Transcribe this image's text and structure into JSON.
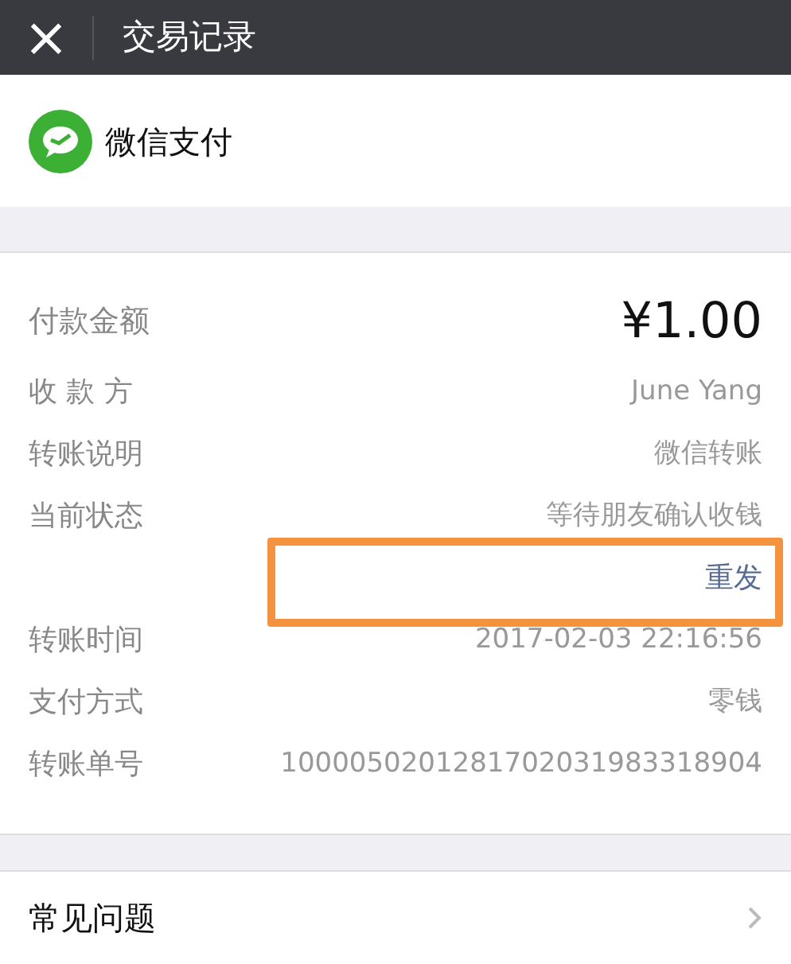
{
  "header": {
    "close": "×",
    "title": "交易记录"
  },
  "brand": {
    "name": "微信支付"
  },
  "amount": {
    "label": "付款金额",
    "value": "¥1.00"
  },
  "details": [
    {
      "label": "收 款 方",
      "value": "June Yang"
    },
    {
      "label": "转账说明",
      "value": "微信转账"
    },
    {
      "label": "当前状态",
      "value": "等待朋友确认收钱",
      "action": "重发"
    },
    {
      "label": "转账时间",
      "value": "2017-02-03 22:16:56"
    },
    {
      "label": "支付方式",
      "value": "零钱"
    },
    {
      "label": "转账单号",
      "value": "1000050201281702031983318904"
    }
  ],
  "faq": {
    "label": "常见问题"
  },
  "annotation": {
    "kind": "rectangle"
  }
}
